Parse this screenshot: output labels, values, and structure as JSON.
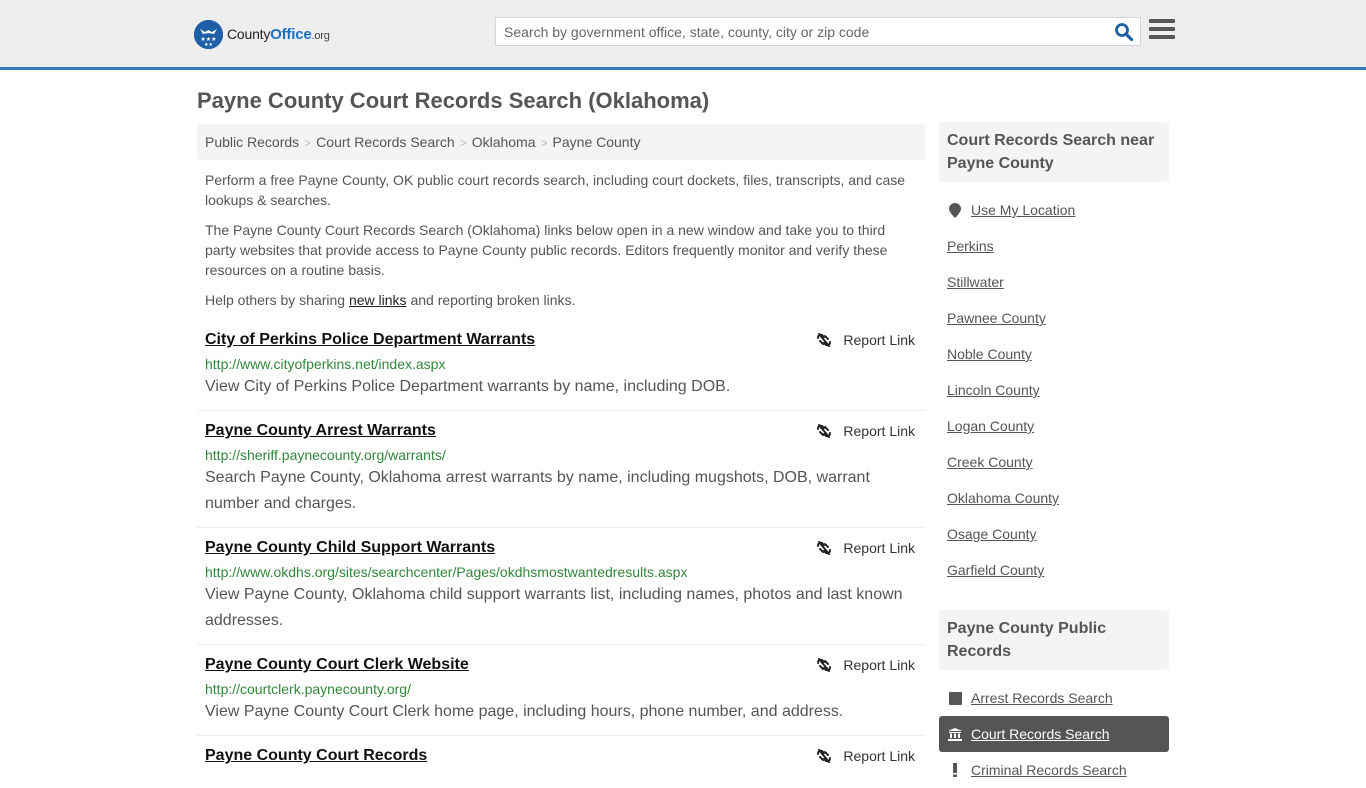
{
  "header": {
    "logo": {
      "county": "County",
      "office": "Office",
      "org": ".org"
    },
    "search_placeholder": "Search by government office, state, county, city or zip code",
    "search_value": ""
  },
  "page_title": "Payne County Court Records Search (Oklahoma)",
  "breadcrumb": [
    {
      "label": "Public Records"
    },
    {
      "label": "Court Records Search"
    },
    {
      "label": "Oklahoma"
    },
    {
      "label": "Payne County"
    }
  ],
  "intro": {
    "p1": "Perform a free Payne County, OK public court records search, including court dockets, files, transcripts, and case lookups & searches.",
    "p2": "The Payne County Court Records Search (Oklahoma) links below open in a new window and take you to third party websites that provide access to Payne County public records. Editors frequently monitor and verify these resources on a routine basis.",
    "p3_before": "Help others by sharing ",
    "p3_link": "new links",
    "p3_after": " and reporting broken links."
  },
  "report_label": "Report Link",
  "links": [
    {
      "title": "City of Perkins Police Department Warrants",
      "url": "http://www.cityofperkins.net/index.aspx",
      "description": "View City of Perkins Police Department warrants by name, including DOB."
    },
    {
      "title": "Payne County Arrest Warrants",
      "url": "http://sheriff.paynecounty.org/warrants/",
      "description": "Search Payne County, Oklahoma arrest warrants by name, including mugshots, DOB, warrant number and charges."
    },
    {
      "title": "Payne County Child Support Warrants",
      "url": "http://www.okdhs.org/sites/searchcenter/Pages/okdhsmostwantedresults.aspx",
      "description": "View Payne County, Oklahoma child support warrants list, including names, photos and last known addresses."
    },
    {
      "title": "Payne County Court Clerk Website",
      "url": "http://courtclerk.paynecounty.org/",
      "description": "View Payne County Court Clerk home page, including hours, phone number, and address."
    },
    {
      "title": "Payne County Court Records",
      "url": "",
      "description": ""
    }
  ],
  "sidebar": {
    "nearby_heading": "Court Records Search near Payne County",
    "use_location": "Use My Location",
    "nearby": [
      "Perkins",
      "Stillwater",
      "Pawnee County",
      "Noble County",
      "Lincoln County",
      "Logan County",
      "Creek County",
      "Oklahoma County",
      "Osage County",
      "Garfield County"
    ],
    "public_records_heading": "Payne County Public Records",
    "public_records": [
      {
        "label": "Arrest Records Search",
        "icon": "square-icon",
        "active": false
      },
      {
        "label": "Court Records Search",
        "icon": "courthouse-icon",
        "active": true
      },
      {
        "label": "Criminal Records Search",
        "icon": "exclamation-icon",
        "active": false
      }
    ]
  },
  "colors": {
    "accent": "#337ab7",
    "url_green": "#31873a",
    "active_bg": "#555555",
    "header_bg": "#eeeeee"
  }
}
